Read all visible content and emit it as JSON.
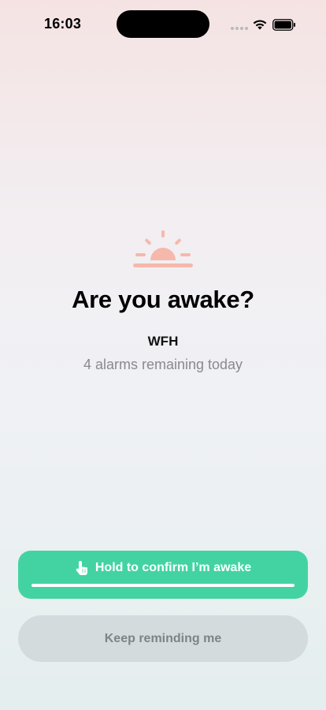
{
  "status_bar": {
    "time": "16:03",
    "icons": [
      "signal-dots-icon",
      "wifi-icon",
      "battery-icon"
    ]
  },
  "main": {
    "illustration": "sunrise-icon",
    "title": "Are you awake?",
    "alarm_name": "WFH",
    "alarm_remaining": "4 alarms remaining today"
  },
  "actions": {
    "confirm_label": "Hold to confirm I’m awake",
    "confirm_icon": "hand-tap-icon",
    "hold_progress": 1.0,
    "remind_label": "Keep reminding me"
  },
  "colors": {
    "accent": "#43d3a3",
    "sun": "#f6b8ab",
    "secondary_button": "#d4dbdc",
    "secondary_text": "#8a8a8e"
  }
}
